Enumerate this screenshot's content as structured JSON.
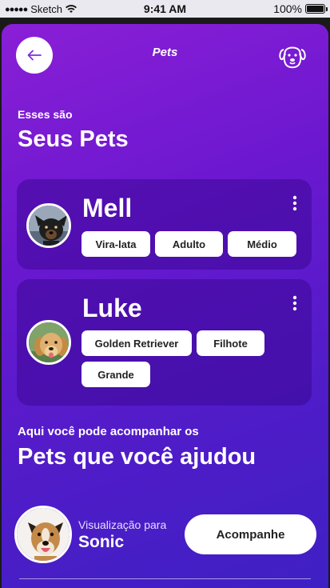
{
  "status_bar": {
    "carrier": "Sketch",
    "time": "9:41 AM",
    "battery": "100%"
  },
  "header": {
    "title": "Pets",
    "back_icon": "arrow-left-icon",
    "right_icon": "dog-face-icon"
  },
  "my_pets": {
    "subtitle": "Esses são",
    "title": "Seus Pets"
  },
  "pets": [
    {
      "name": "Mell",
      "tags": [
        "Vira-lata",
        "Adulto",
        "Médio"
      ]
    },
    {
      "name": "Luke",
      "tags": [
        "Golden Retriever",
        "Filhote",
        "Grande"
      ]
    }
  ],
  "helped": {
    "subtitle": "Aqui você pode acompanhar os",
    "title": "Pets que você ajudou"
  },
  "preview": {
    "label": "Visualização para",
    "name": "Sonic",
    "button": "Acompanhe"
  },
  "colors": {
    "gradient_start": "#8a1fd6",
    "gradient_end": "#3e20c4",
    "card": "#3c0896",
    "accent": "#6b18d0"
  }
}
